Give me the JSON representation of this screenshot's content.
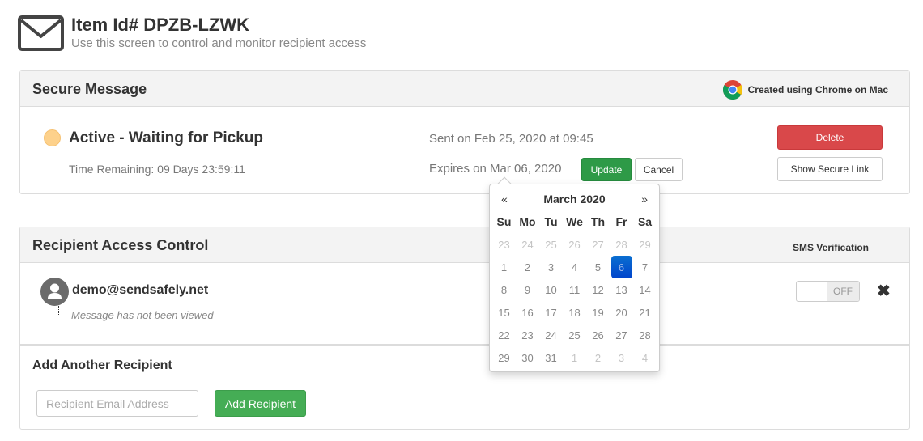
{
  "header": {
    "icon": "envelope-icon",
    "title": "Item Id# DPZB-LZWK",
    "subtitle": "Use this screen to control and monitor recipient access"
  },
  "secure_message": {
    "title": "Secure Message",
    "created_icon": "chrome-icon",
    "created_text": "Created using Chrome on Mac",
    "status_color": "#fdd18b",
    "status": "Active - Waiting for Pickup",
    "time_remaining": "Time Remaining: 09 Days 23:59:11",
    "sent_on": "Sent on Feb 25, 2020 at 09:45",
    "expires_on": "Expires on Mar 06, 2020",
    "update_label": "Update",
    "cancel_label": "Cancel",
    "delete_label": "Delete",
    "show_link_label": "Show Secure Link"
  },
  "datepicker": {
    "prev": "«",
    "next": "»",
    "month": "March 2020",
    "weekdays": [
      "Su",
      "Mo",
      "Tu",
      "We",
      "Th",
      "Fr",
      "Sa"
    ],
    "weeks": [
      [
        {
          "d": "23",
          "old": true
        },
        {
          "d": "24",
          "old": true
        },
        {
          "d": "25",
          "old": true
        },
        {
          "d": "26",
          "old": true
        },
        {
          "d": "27",
          "old": true
        },
        {
          "d": "28",
          "old": true
        },
        {
          "d": "29",
          "old": true
        }
      ],
      [
        {
          "d": "1"
        },
        {
          "d": "2"
        },
        {
          "d": "3"
        },
        {
          "d": "4"
        },
        {
          "d": "5"
        },
        {
          "d": "6",
          "active": true
        },
        {
          "d": "7"
        }
      ],
      [
        {
          "d": "8"
        },
        {
          "d": "9"
        },
        {
          "d": "10"
        },
        {
          "d": "11"
        },
        {
          "d": "12"
        },
        {
          "d": "13"
        },
        {
          "d": "14"
        }
      ],
      [
        {
          "d": "15"
        },
        {
          "d": "16"
        },
        {
          "d": "17"
        },
        {
          "d": "18"
        },
        {
          "d": "19"
        },
        {
          "d": "20"
        },
        {
          "d": "21"
        }
      ],
      [
        {
          "d": "22"
        },
        {
          "d": "23"
        },
        {
          "d": "24"
        },
        {
          "d": "25"
        },
        {
          "d": "26"
        },
        {
          "d": "27"
        },
        {
          "d": "28"
        }
      ],
      [
        {
          "d": "29"
        },
        {
          "d": "30"
        },
        {
          "d": "31"
        },
        {
          "d": "1",
          "old": true
        },
        {
          "d": "2",
          "old": true
        },
        {
          "d": "3",
          "old": true
        },
        {
          "d": "4",
          "old": true
        }
      ]
    ],
    "selected_color": "#0a6fd0"
  },
  "recipient_access": {
    "title": "Recipient Access Control",
    "sms_label": "SMS Verification",
    "recipients": [
      {
        "email": "demo@sendsafely.net",
        "status": "Message has not been viewed",
        "sms_toggle": "OFF",
        "remove_icon": "close-icon"
      }
    ],
    "add_title": "Add Another Recipient",
    "email_placeholder": "Recipient Email Address",
    "email_value": "",
    "add_label": "Add Recipient"
  },
  "colors": {
    "delete": "#d9484a",
    "update": "#2e9a47",
    "add": "#45ad55"
  }
}
